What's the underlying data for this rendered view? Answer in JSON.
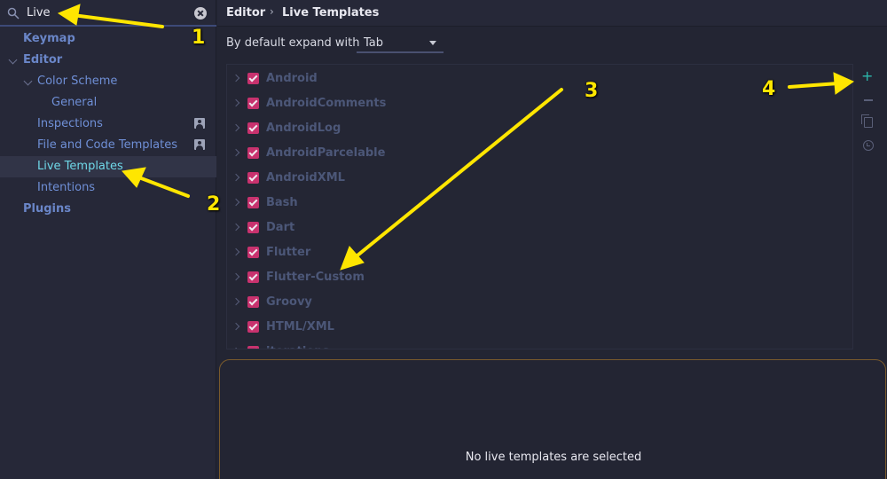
{
  "search": {
    "value": "Live"
  },
  "sidebar": {
    "items": [
      {
        "label": "Keymap"
      },
      {
        "label": "Editor"
      },
      {
        "label": "Color Scheme"
      },
      {
        "label": "General"
      },
      {
        "label": "Inspections"
      },
      {
        "label": "File and Code Templates"
      },
      {
        "label": "Live Templates"
      },
      {
        "label": "Intentions"
      },
      {
        "label": "Plugins"
      }
    ]
  },
  "header": {
    "crumb1": "Editor",
    "separator": "›",
    "crumb2": "Live Templates"
  },
  "expand": {
    "label": "By default expand with",
    "value": "Tab"
  },
  "templates": [
    "Android",
    "AndroidComments",
    "AndroidLog",
    "AndroidParcelable",
    "AndroidXML",
    "Bash",
    "Dart",
    "Flutter",
    "Flutter-Custom",
    "Groovy",
    "HTML/XML",
    "iterations"
  ],
  "toolbar": {
    "plus": "+"
  },
  "detail": {
    "empty_text": "No live templates are selected"
  },
  "annotations": {
    "n1": "1",
    "n2": "2",
    "n3": "3",
    "n4": "4"
  },
  "colors": {
    "accent": "#6fd8e8",
    "checkbox": "#c8326e",
    "arrow": "#ffe600",
    "add": "#2cb8ac"
  }
}
